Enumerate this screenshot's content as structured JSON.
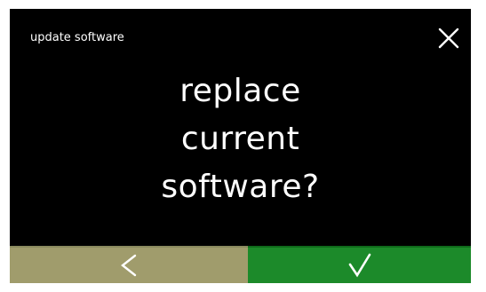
{
  "header": {
    "title": "update software",
    "close_icon": "close-icon"
  },
  "message": {
    "lines": [
      "replace",
      "current",
      "software?"
    ]
  },
  "footer": {
    "back_icon": "chevron-left-icon",
    "confirm_icon": "check-icon"
  },
  "colors": {
    "background": "#000000",
    "text": "#ffffff",
    "back_button": "#a09c6c",
    "confirm_button": "#1c8a2a",
    "outer_border": "#ffffff"
  }
}
